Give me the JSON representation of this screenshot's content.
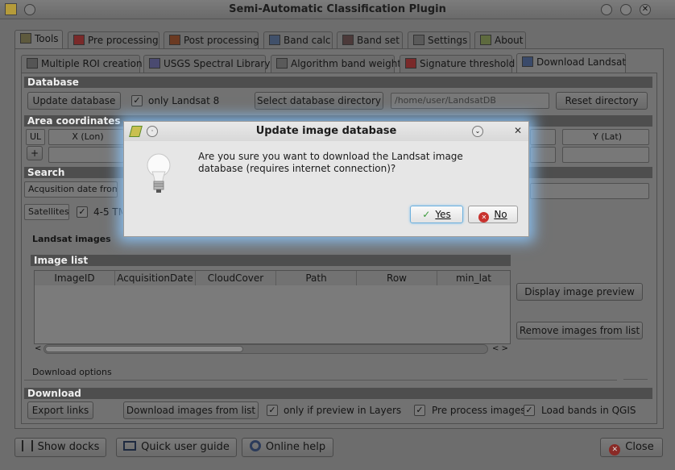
{
  "window": {
    "title": "Semi-Automatic Classification Plugin"
  },
  "tabs": [
    {
      "label": "Tools",
      "icon": "tools-icon"
    },
    {
      "label": "Pre processing",
      "icon": "pre-processing-icon"
    },
    {
      "label": "Post processing",
      "icon": "post-processing-icon"
    },
    {
      "label": "Band calc",
      "icon": "band-calc-icon"
    },
    {
      "label": "Band set",
      "icon": "band-set-icon"
    },
    {
      "label": "Settings",
      "icon": "settings-icon"
    },
    {
      "label": "About",
      "icon": "about-icon"
    }
  ],
  "subtabs": [
    {
      "label": "Multiple ROI creation"
    },
    {
      "label": "USGS Spectral Library"
    },
    {
      "label": "Algorithm band weight"
    },
    {
      "label": "Signature threshold"
    },
    {
      "label": "Download Landsat"
    }
  ],
  "database": {
    "header": "Database",
    "update_button": "Update database",
    "only_landsat8_label": "only Landsat 8",
    "only_landsat8_checked": true,
    "select_dir_button": "Select database directory",
    "dir_value": "/home/user/LandsatDB",
    "reset_button": "Reset directory"
  },
  "area": {
    "header": "Area coordinates",
    "ul_label": "UL",
    "x_label": "X (Lon)",
    "y_label": "Y (Lat)",
    "add_button": "+"
  },
  "search": {
    "header": "Search",
    "date_label": "Acqusition date from",
    "satellites_label": "Satellites",
    "sat_45_label": "4-5 TM"
  },
  "landsat_images_label": "Landsat images",
  "image_list": {
    "header": "Image list",
    "columns": [
      "ImageID",
      "AcquisitionDate",
      "CloudCover",
      "Path",
      "Row",
      "min_lat"
    ],
    "preview_button": "Display image preview",
    "remove_button": "Remove images from list"
  },
  "download_options_label": "Download options",
  "download": {
    "header": "Download",
    "export_button": "Export links",
    "download_button": "Download images from list",
    "only_preview_label": "only if preview in Layers",
    "preprocess_label": "Pre process images",
    "load_bands_label": "Load bands in QGIS"
  },
  "footer": {
    "show_docks": "Show docks",
    "quick_guide": "Quick user guide",
    "online_help": "Online help",
    "close": "Close"
  },
  "dialog": {
    "title": "Update image database",
    "message": "Are you sure you want to download the Landsat image database (requires internet connection)?",
    "yes": "Yes",
    "no": "No"
  },
  "colors": {
    "accent": "#6eb0dc",
    "close_red": "#c8322e",
    "yes_green": "#3a9a3a"
  }
}
